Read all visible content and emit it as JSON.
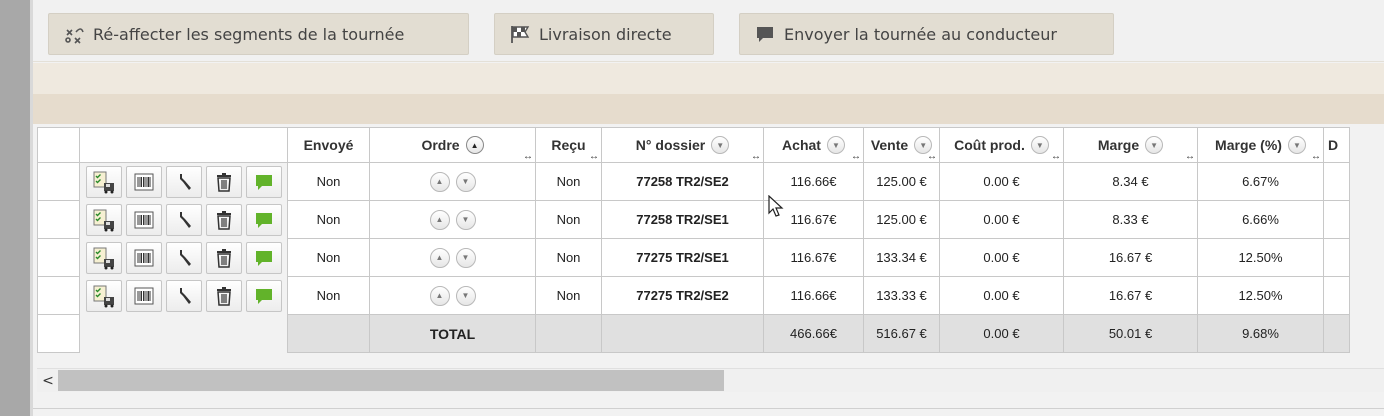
{
  "toolbar": {
    "reassign_label": "Ré-affecter les segments de la tournée",
    "direct_label": "Livraison directe",
    "send_label": "Envoyer la tournée au conducteur"
  },
  "table": {
    "headers": {
      "envoye": "Envoyé",
      "ordre": "Ordre",
      "recu": "Reçu",
      "dossier": "N° dossier",
      "achat": "Achat",
      "vente": "Vente",
      "cout": "Coût prod.",
      "marge": "Marge",
      "marge_pct": "Marge (%)",
      "next": "D"
    },
    "rows": [
      {
        "envoye": "Non",
        "recu": "Non",
        "dossier": "77258 TR2/SE2",
        "achat": "116.66€",
        "vente": "125.00 €",
        "cout": "0.00 €",
        "marge": "8.34 €",
        "marge_pct": "6.67%"
      },
      {
        "envoye": "Non",
        "recu": "Non",
        "dossier": "77258 TR2/SE1",
        "achat": "116.67€",
        "vente": "125.00 €",
        "cout": "0.00 €",
        "marge": "8.33 €",
        "marge_pct": "6.66%"
      },
      {
        "envoye": "Non",
        "recu": "Non",
        "dossier": "77275 TR2/SE1",
        "achat": "116.67€",
        "vente": "133.34 €",
        "cout": "0.00 €",
        "marge": "16.67 €",
        "marge_pct": "12.50%"
      },
      {
        "envoye": "Non",
        "recu": "Non",
        "dossier": "77275 TR2/SE2",
        "achat": "116.66€",
        "vente": "133.33 €",
        "cout": "0.00 €",
        "marge": "16.67 €",
        "marge_pct": "12.50%"
      }
    ],
    "total": {
      "label": "TOTAL",
      "achat": "466.66€",
      "vente": "516.67 €",
      "cout": "0.00 €",
      "marge": "50.01 €",
      "marge_pct": "9.68%"
    }
  },
  "scrollbar": {
    "left_arrow": "<"
  },
  "colors": {
    "toolbar_button": "#e2ddd2",
    "band_light": "#efe9df",
    "band_dark": "#e6dccd",
    "chat_green": "#62b32a",
    "total_row": "#e0e0e0"
  }
}
